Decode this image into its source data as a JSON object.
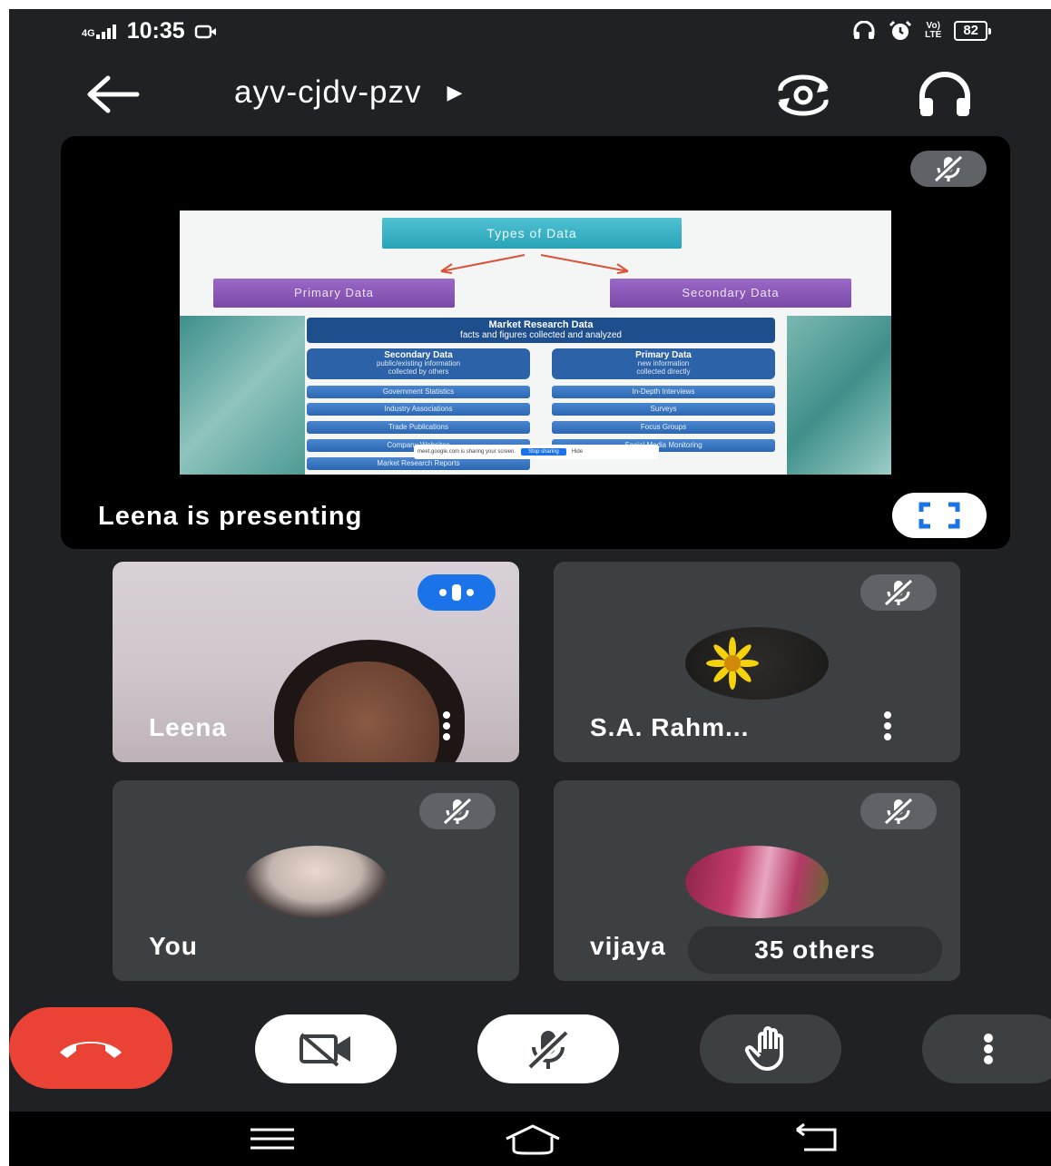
{
  "status_bar": {
    "network": "4G",
    "time": "10:35",
    "volte": "Vo)\nLTE",
    "battery": "82"
  },
  "app_bar": {
    "meeting_code": "ayv-cjdv-pzv",
    "code_indicator": "▶"
  },
  "presentation": {
    "presenting_label": "Leena is presenting",
    "slide": {
      "title": "Types of Data",
      "left_branch": "Primary Data",
      "right_branch": "Secondary Data",
      "box_title": "Market Research Data",
      "box_subtitle": "facts and figures collected and analyzed",
      "secondary_head": "Secondary Data",
      "secondary_sub1": "public/existing information",
      "secondary_sub2": "collected by others",
      "primary_head": "Primary Data",
      "primary_sub1": "new information",
      "primary_sub2": "collected directly",
      "secondary_items": [
        "Government Statistics",
        "Industry Associations",
        "Trade Publications",
        "Company Websites",
        "Market Research Reports"
      ],
      "primary_items": [
        "In-Depth Interviews",
        "Surveys",
        "Focus Groups",
        "Social Media Monitoring"
      ],
      "share_notice": "meet.google.com is sharing your screen.",
      "share_stop": "Stop sharing",
      "share_hide": "Hide"
    }
  },
  "participants": [
    {
      "name": "Leena",
      "state": "speaking"
    },
    {
      "name": "S.A. Rahm...",
      "state": "muted"
    },
    {
      "name": "You",
      "state": "muted"
    },
    {
      "name": "vijaya",
      "state": "muted"
    }
  ],
  "others_chip": "35 others",
  "colors": {
    "background": "#202124",
    "tile": "#3c4043",
    "end_call": "#ea4335",
    "speaking": "#1a73e8",
    "mute_chip": "#5f6368"
  }
}
